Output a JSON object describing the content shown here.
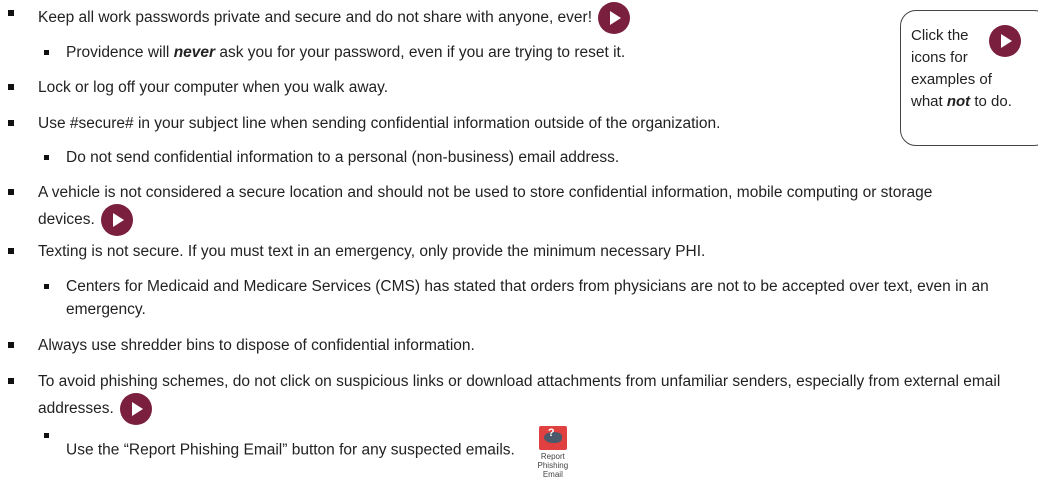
{
  "bullets": {
    "b1": {
      "text": "Keep all work passwords private and secure and do not share with anyone, ever!"
    },
    "b1a": {
      "pre": "Providence will ",
      "em": "never",
      "post": " ask you for your password, even if you are trying to reset it."
    },
    "b2": {
      "text": "Lock or log off your computer when you walk away."
    },
    "b3": {
      "text": "Use #secure# in your subject line when sending confidential information outside of the organization."
    },
    "b3a": {
      "text": "Do not send confidential information to a personal (non-business) email address."
    },
    "b4": {
      "text": "A vehicle is not considered a secure location and should not be used to store confidential information, mobile computing or storage devices."
    },
    "b5": {
      "text": "Texting is not secure. If you must text in an emergency, only provide the minimum necessary PHI."
    },
    "b5a": {
      "text": "Centers for Medicaid and Medicare Services (CMS) has stated that orders from physicians are not to be accepted over text, even in an emergency."
    },
    "b6": {
      "text": "Always use shredder bins to dispose of confidential information."
    },
    "b7": {
      "text": "To avoid phishing schemes, do not click on suspicious links or download attachments from unfamiliar senders, especially from external email addresses."
    },
    "b7a": {
      "text": "Use the “Report Phishing Email” button for any suspected emails."
    }
  },
  "callout": {
    "line1": "Click the",
    "line2": "icons for",
    "line3": "examples of",
    "line4_pre": "what ",
    "line4_em": "not",
    "line4_post": " to do."
  },
  "report_button": {
    "label": "Report Phishing Email",
    "icon": "phishing-fish-icon"
  },
  "colors": {
    "play_button": "#7a1f3d",
    "report_icon": "#e04040"
  }
}
